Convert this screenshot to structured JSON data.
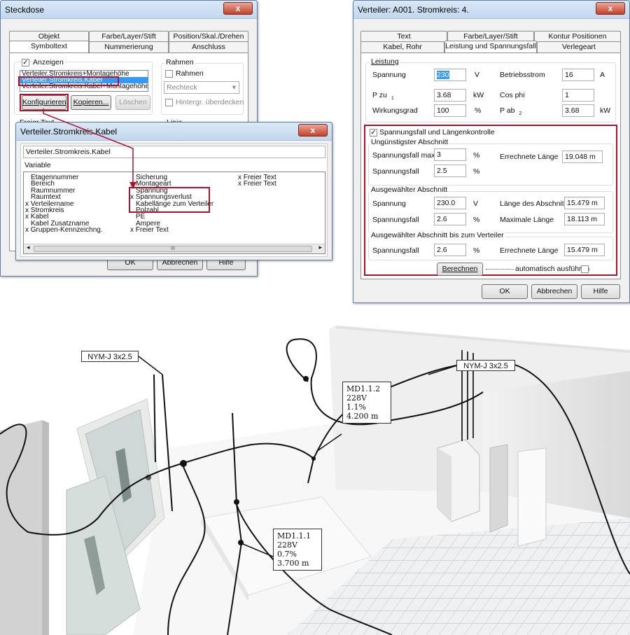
{
  "steckdose": {
    "title": "Steckdose",
    "close": "x",
    "tabs_row1": [
      "Objekt",
      "Farbe/Layer/Stift",
      "Position/Skal./Drehen"
    ],
    "tabs_row2": [
      "Symboltext",
      "Nummerierung",
      "Anschluss"
    ],
    "anzeigen_label": "Anzeigen",
    "list_items": [
      "Verteiler.Stromkreis+Montagehöhe",
      "Verteiler.Stromkreis.Kabel",
      "Verteiler.Stromkreis.Kabel+Montagehöhe"
    ],
    "btn_konfigurieren": "Konfigurieren",
    "btn_kopieren": "Kopieren...",
    "btn_loeschen": "Löschen",
    "rahmen_group": "Rahmen",
    "rahmen_check": "Rahmen",
    "rahmen_select": "Rechteck",
    "hintergr": "Hintergr. überdecken",
    "freier_text": "Freier Text",
    "linie": "Linie",
    "ok": "OK",
    "abbrechen": "Abbrechen",
    "hilfe": "Hilfe"
  },
  "kabel_dialog": {
    "title": "Verteiler.Stromkreis.Kabel",
    "name_value": "Verteiler.Stromkreis.Kabel",
    "variable_label": "Variable",
    "col1": [
      "Etagennummer",
      "Bereich",
      "Raumnummer",
      "Raumtext",
      "x Verteilername",
      "x Stromkreis",
      "x Kabel",
      "Kabel Zusatzname",
      "x Gruppen-Kennzeichng."
    ],
    "col2": [
      "Sicherung",
      "Montageart",
      "Spannung",
      "x Spannungsverlust",
      "Kabellänge zum Verteiler",
      "Polzahl",
      "PE",
      "Ampere",
      "x Freier Text"
    ],
    "col3": [
      "x Freier Text",
      "x Freier Text"
    ],
    "scroll_mid": "III"
  },
  "verteiler": {
    "title": "Verteiler: A001. Stromkreis: 4.",
    "close": "x",
    "tabs_row1": [
      "Text",
      "Farbe/Layer/Stift",
      "Kontur Positionen"
    ],
    "tabs_row2": [
      "Kabel, Rohr",
      "Leistung und Spannungsfall",
      "Verlegeart"
    ],
    "leistung": {
      "group": "Leistung",
      "spannung_label": "Spannung",
      "spannung_value": "230",
      "spannung_unit": "V",
      "betriebsstrom_label": "Betriebsstrom",
      "betriebsstrom_value": "16",
      "betriebsstrom_unit": "A",
      "pzu_label": "P zu",
      "pzu_sub": "1",
      "pzu_value": "3.68",
      "pzu_unit": "kW",
      "cosphi_label": "Cos phi",
      "cosphi_value": "1",
      "wirk_label": "Wirkungsgrad",
      "wirk_value": "100",
      "wirk_unit": "%",
      "pab_label": "P ab",
      "pab_sub": "2",
      "pab_value": "3.68",
      "pab_unit": "kW"
    },
    "spannungsfall_check": "Spannungsfall und Längenkontrolle",
    "ungunstig": {
      "group": "Ungünstigster Abschnitt",
      "sfmax_label": "Spannungsfall max",
      "sfmax_value": "3",
      "sfmax_unit": "%",
      "errlaenge_label": "Errechnete Länge",
      "errlaenge_value": "19.048 m",
      "sf_label": "Spannungsfall",
      "sf_value": "2.5",
      "sf_unit": "%"
    },
    "ausgewaehlt": {
      "group": "Ausgewählter Abschnitt",
      "spannung_label": "Spannung",
      "spannung_value": "230.0",
      "spannung_unit": "V",
      "laenge_label": "Länge des Abschnitts",
      "laenge_value": "15.479 m",
      "sf_label": "Spannungsfall",
      "sf_value": "2.6",
      "sf_unit": "%",
      "maxlaenge_label": "Maximale Länge",
      "maxlaenge_value": "18.113 m"
    },
    "bis_verteiler": {
      "group": "Ausgewählter Abschnitt bis zum Verteiler",
      "sf_label": "Spannungsfall",
      "sf_value": "2.6",
      "sf_unit": "%",
      "errlaenge_label": "Errechnete Länge",
      "errlaenge_value": "15.479 m"
    },
    "berechnen": "Berechnen",
    "auto_label": "automatisch ausführen",
    "ok": "OK",
    "abbrechen": "Abbrechen",
    "hilfe": "Hilfe"
  },
  "scene": {
    "cable_label_1": "NYM-J 3x2.5",
    "cable_label_2": "NYM-J 3x2.5",
    "md112": [
      "MD1.1.2",
      "228V",
      "1.1%",
      "4.200 m"
    ],
    "md111": [
      "MD1.1.1",
      "228V",
      "0.7%",
      "3.700 m"
    ]
  },
  "colors": {
    "highlight_red": "#b0122a",
    "selection_blue": "#3399ff",
    "title_gradient": "#c2d7ee"
  }
}
